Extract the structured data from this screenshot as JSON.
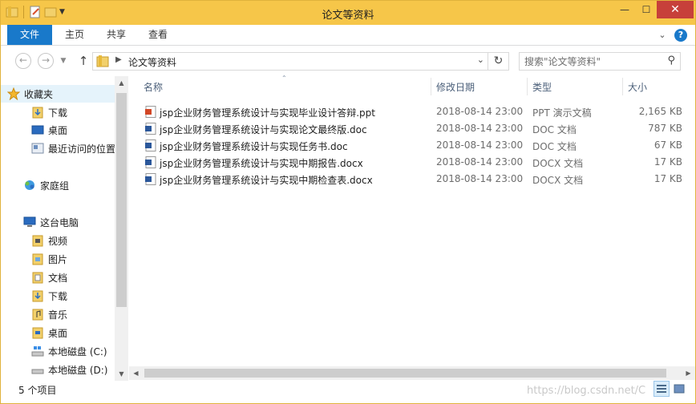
{
  "window": {
    "title": "论文等资料"
  },
  "ribbon": {
    "tabs": [
      "文件",
      "主页",
      "共享",
      "查看"
    ]
  },
  "address": {
    "crumb": "论文等资料"
  },
  "search": {
    "placeholder": "搜索\"论文等资料\""
  },
  "nav": {
    "favorites": "收藏夹",
    "downloads": "下载",
    "desktop": "桌面",
    "recent": "最近访问的位置",
    "homegroup": "家庭组",
    "thispc": "这台电脑",
    "videos": "视频",
    "pictures": "图片",
    "documents": "文档",
    "downloads2": "下载",
    "music": "音乐",
    "desktop2": "桌面",
    "drive_c": "本地磁盘 (C:)",
    "drive_d": "本地磁盘 (D:)"
  },
  "columns": {
    "name": "名称",
    "modified": "修改日期",
    "type": "类型",
    "size": "大小"
  },
  "files": [
    {
      "name": "jsp企业财务管理系统设计与实现毕业设计答辩.ppt",
      "date": "2018-08-14 23:00",
      "type": "PPT 演示文稿",
      "size": "2,165 KB",
      "kind": "ppt"
    },
    {
      "name": "jsp企业财务管理系统设计与实现论文最终版.doc",
      "date": "2018-08-14 23:00",
      "type": "DOC 文档",
      "size": "787 KB",
      "kind": "doc"
    },
    {
      "name": "jsp企业财务管理系统设计与实现任务书.doc",
      "date": "2018-08-14 23:00",
      "type": "DOC 文档",
      "size": "67 KB",
      "kind": "doc"
    },
    {
      "name": "jsp企业财务管理系统设计与实现中期报告.docx",
      "date": "2018-08-14 23:00",
      "type": "DOCX 文档",
      "size": "17 KB",
      "kind": "doc"
    },
    {
      "name": "jsp企业财务管理系统设计与实现中期检查表.docx",
      "date": "2018-08-14 23:00",
      "type": "DOCX 文档",
      "size": "17 KB",
      "kind": "doc"
    }
  ],
  "status": {
    "count": "5 个项目",
    "watermark": "https://blog.csdn.net/C"
  },
  "colors": {
    "titlebar": "#f6c649",
    "file_tab": "#1979ca",
    "close": "#c7403a",
    "selected_nav": "#e5f3fb"
  }
}
